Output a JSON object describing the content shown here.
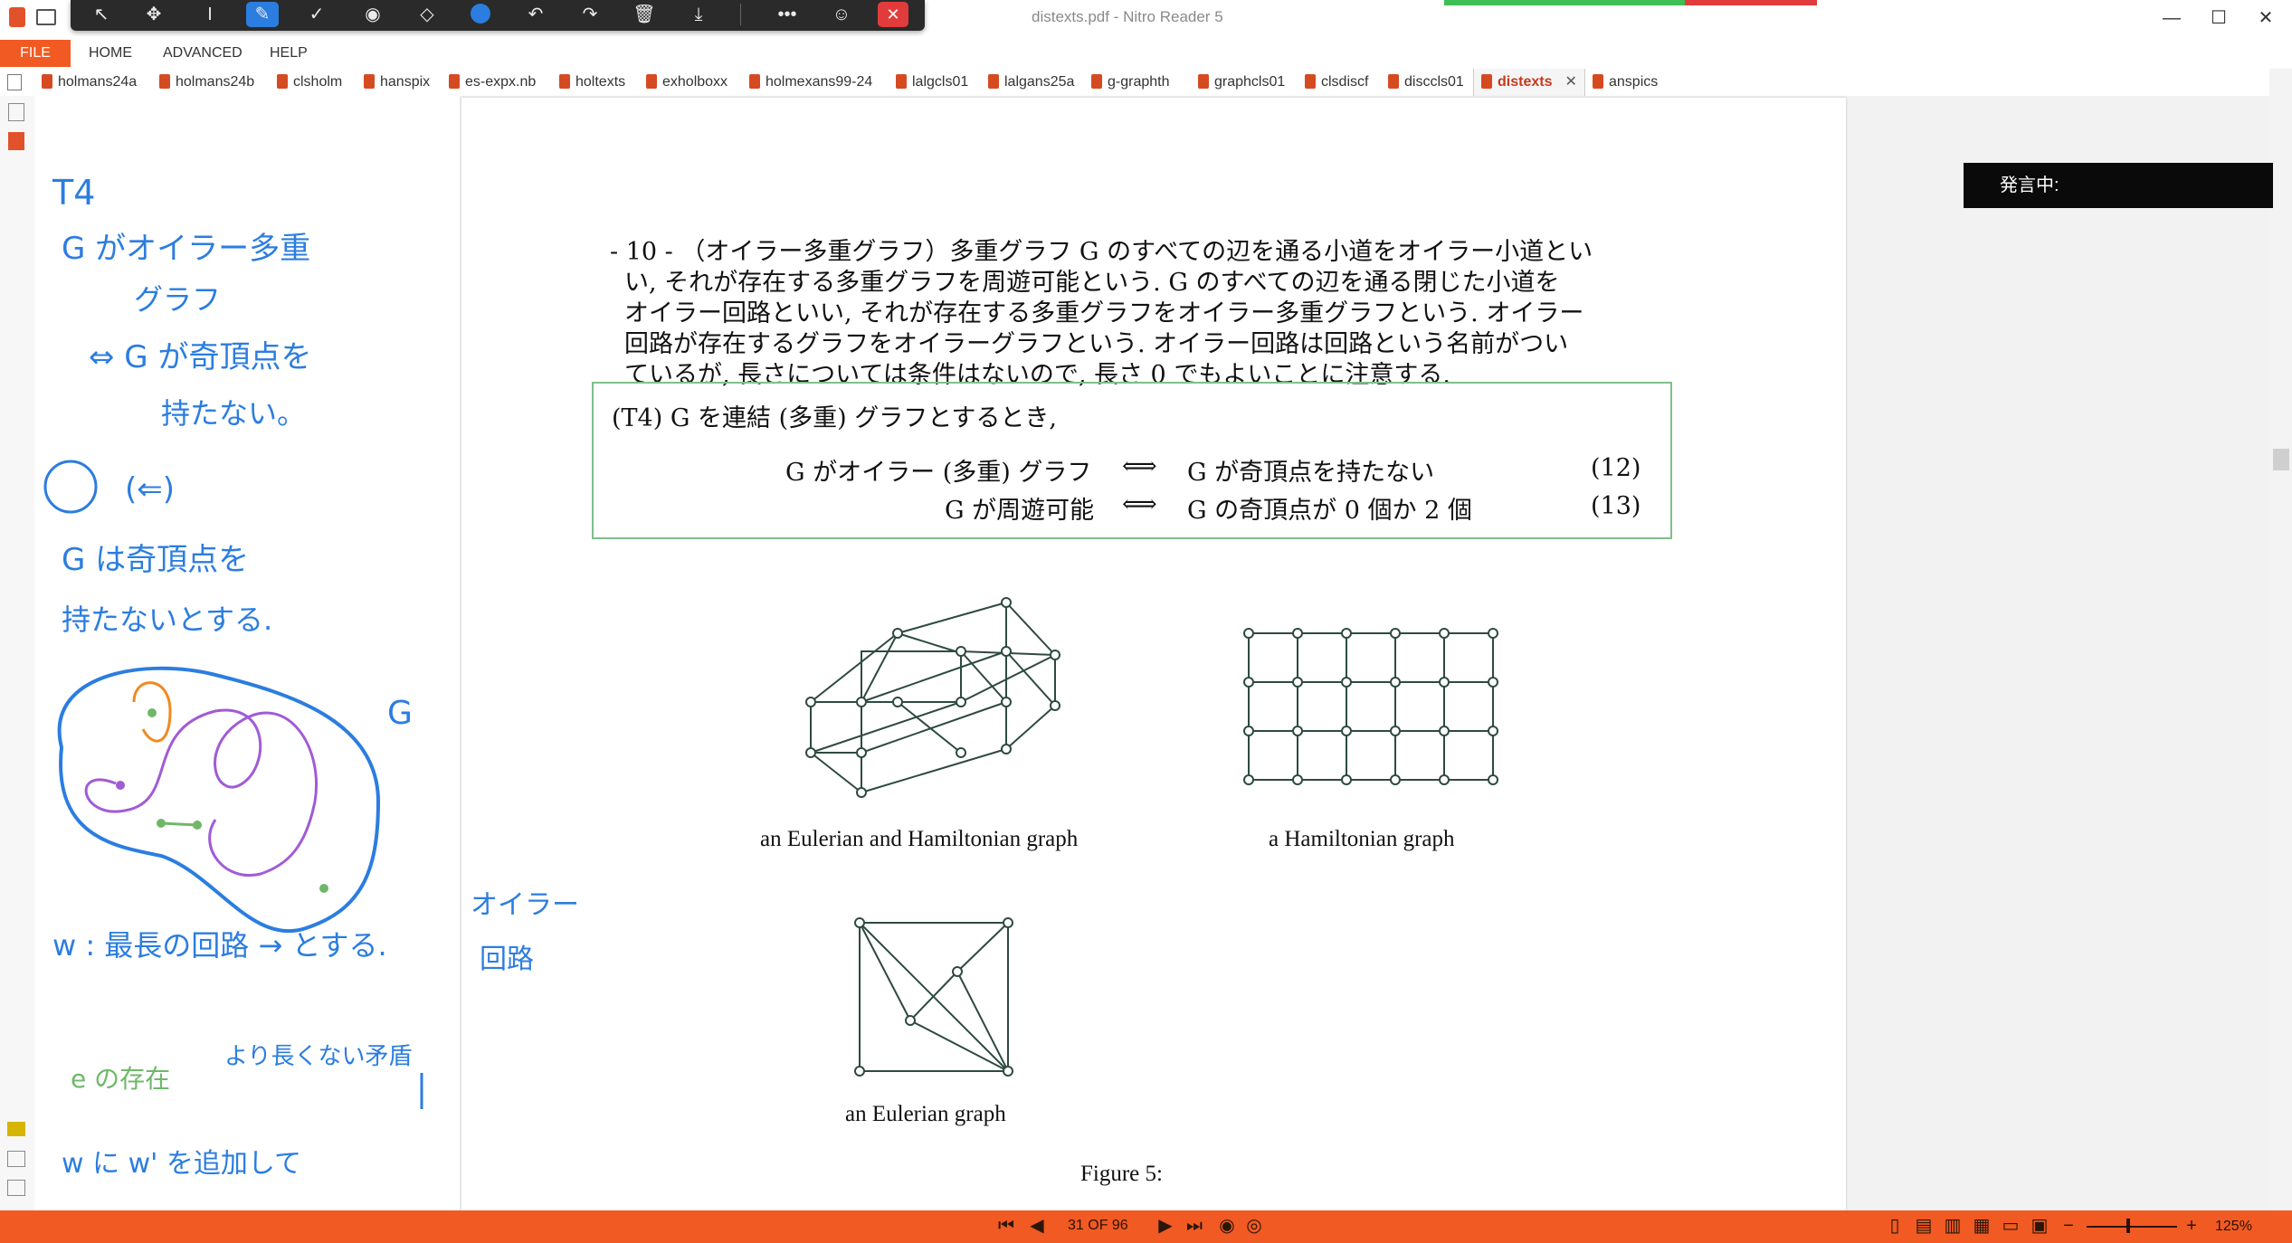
{
  "window": {
    "title": "distexts.pdf - Nitro Reader 5",
    "controls": [
      "—",
      "☐",
      "✕"
    ]
  },
  "toolbar": {
    "icons": [
      "pointer-icon",
      "move-icon",
      "text-cursor-icon",
      "pen-icon",
      "check-icon",
      "stamp-icon",
      "eraser-icon",
      "color-dot-icon",
      "undo-icon",
      "redo-icon",
      "trash-icon",
      "download-icon",
      "more-icon",
      "person-icon",
      "close-icon"
    ]
  },
  "menu": {
    "file": "FILE",
    "items": [
      "HOME",
      "ADVANCED",
      "HELP"
    ]
  },
  "tabs": [
    {
      "label": "holmans24a"
    },
    {
      "label": "holmans24b"
    },
    {
      "label": "clsholm"
    },
    {
      "label": "hanspix"
    },
    {
      "label": "es-expx.nb"
    },
    {
      "label": "holtexts"
    },
    {
      "label": "exholboxx"
    },
    {
      "label": "holmexans99-24"
    },
    {
      "label": "lalgcls01"
    },
    {
      "label": "lalgans25a"
    },
    {
      "label": "g-graphth"
    },
    {
      "label": "graphcls01"
    },
    {
      "label": "clsdiscf"
    },
    {
      "label": "disccls01"
    },
    {
      "label": "distexts",
      "active": true
    },
    {
      "label": "anspics"
    }
  ],
  "speaking": "発言中:",
  "document": {
    "para_lines": [
      "- 10 - （オイラー多重グラフ）多重グラフ G のすべての辺を通る小道をオイラー小道とい",
      "い, それが存在する多重グラフを周遊可能という. G のすべての辺を通る閉じた小道を",
      "オイラー回路といい, それが存在する多重グラフをオイラー多重グラフという. オイラー",
      "回路が存在するグラフをオイラーグラフという. オイラー回路は回路という名前がつい",
      "ているが, 長さについては条件はないので, 長さ 0 でもよいことに注意する."
    ],
    "theorem": {
      "heading": "(T4)  G を連結 (多重) グラフとするとき,",
      "eq12_left": "G がオイラー (多重) グラフ",
      "eq12_right": "G が奇頂点を持たない",
      "eq12_num": "(12)",
      "eq13_left": "G が周遊可能",
      "eq13_right": "G の奇頂点が 0 個か 2 個",
      "eq13_num": "(13)",
      "iff": "⟺"
    },
    "captions": {
      "cube": "an Eulerian and Hamiltonian graph",
      "grid": "a Hamiltonian graph",
      "eulerian": "an Eulerian graph",
      "figure": "Figure 5:"
    }
  },
  "handwriting": {
    "lines": [
      "T4",
      "G がオイラー多重",
      "グラフ",
      "⇔ G が奇頂点を",
      "持たない。",
      "(⇐)",
      "G は奇頂点を",
      "持たないとする.",
      "G",
      "w : 最長の回路 → とする.",
      "オイラー",
      "回路",
      "より長くない矛盾",
      "e の存在",
      "w に w' を追加して"
    ]
  },
  "status": {
    "page_indicator": "31 OF 96",
    "zoom": "125%"
  },
  "colors": {
    "accent": "#f15a22",
    "ink_blue": "#2b7de0",
    "ink_purple": "#a05bd6",
    "ink_green": "#6fb86a",
    "ink_orange": "#f08a1e",
    "theorem_border": "#7fc08a"
  }
}
